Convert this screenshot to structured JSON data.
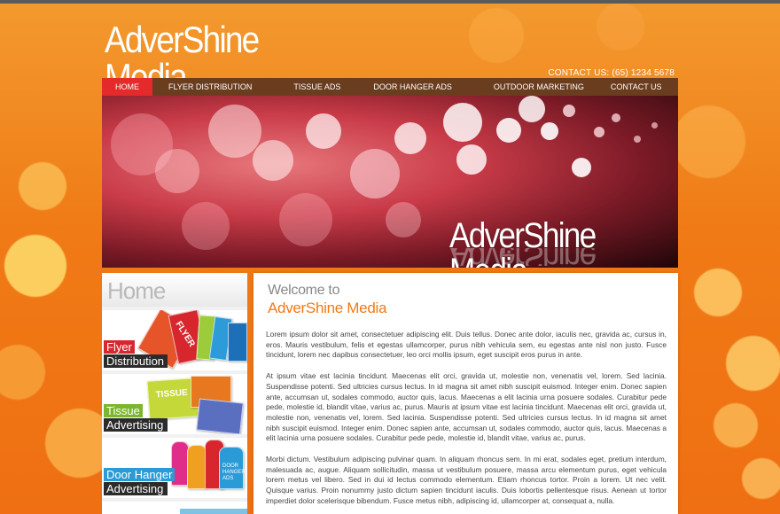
{
  "header": {
    "logo_text": "AdverShine Media",
    "contact": "CONTACT US: (65) 1234 5678"
  },
  "nav": {
    "items": [
      "HOME",
      "FLYER DISTRIBUTION",
      "TISSUE ADS",
      "DOOR HANGER ADS",
      "OUTDOOR MARKETING",
      "CONTACT US"
    ],
    "active": "HOME"
  },
  "banner": {
    "title": "AdverShine Media"
  },
  "sidebar": {
    "heading": "Home",
    "items": [
      {
        "line1": "Flyer",
        "line2": "Distribution",
        "art_text": "FLYER"
      },
      {
        "line1": "Tissue",
        "line2": "Advertising",
        "art_text": "TISSUE"
      },
      {
        "line1": "Door Hanger",
        "line2": "Advertising",
        "art_text": "DOOR HANGER ADS"
      }
    ]
  },
  "content": {
    "welcome_line1": "Welcome to",
    "welcome_line2": "AdverShine Media",
    "paragraphs": [
      "Lorem ipsum dolor sit amet, consectetuer adipiscing elit. Duis tellus. Donec ante dolor, iaculis nec, gravida ac, cursus in, eros. Mauris vestibulum, felis et egestas ullamcorper, purus nibh vehicula sem, eu egestas ante nisl non justo. Fusce tincidunt, lorem nec dapibus consectetuer, leo orci mollis ipsum, eget suscipit eros purus in ante.",
      "At ipsum vitae est lacinia tincidunt. Maecenas elit orci, gravida ut, molestie non, venenatis vel, lorem. Sed lacinia. Suspendisse potenti. Sed ultricies cursus lectus. In id magna sit amet nibh suscipit euismod. Integer enim. Donec sapien ante, accumsan ut, sodales commodo, auctor quis, lacus. Maecenas a elit lacinia urna posuere sodales. Curabitur pede pede, molestie id, blandit vitae, varius ac, purus. Mauris at ipsum vitae est lacinia tincidunt. Maecenas elit orci, gravida ut, molestie non, venenatis vel, lorem. Sed lacinia. Suspendisse potenti. Sed ultricies cursus lectus. In id magna sit amet nibh suscipit euismod. Integer enim. Donec sapien ante, accumsan ut, sodales commodo, auctor quis, lacus. Maecenas a elit lacinia urna posuere sodales. Curabitur pede pede, molestie id, blandit vitae, varius ac, purus.",
      "Morbi dictum. Vestibulum adipiscing pulvinar quam. In aliquam rhoncus sem. In mi erat, sodales eget, pretium interdum, malesuada ac, augue. Aliquam sollicitudin, massa ut vestibulum posuere, massa arcu elementum purus, eget vehicula lorem metus vel libero. Sed in dui id lectus commodo elementum. Etiam rhoncus tortor. Proin a lorem. Ut nec velit. Quisque varius. Proin nonummy justo dictum sapien tincidunt iaculis. Duis lobortis pellentesque risus. Aenean ut tortor imperdiet dolor scelerisque bibendum. Fusce metus nibh, adipiscing id, ullamcorper at, consequat a, nulla."
    ]
  },
  "colors": {
    "accent_orange": "#f07a16",
    "nav_brown": "#6b3d1f",
    "nav_active_red": "#e42a2a"
  }
}
